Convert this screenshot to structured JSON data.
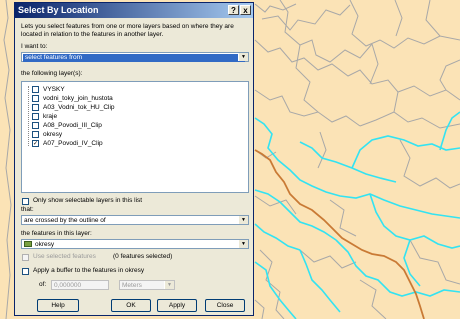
{
  "dialog": {
    "title": "Select By Location",
    "help_glyph": "?",
    "close_glyph": "x",
    "intro": "Lets you select features from one or more layers based on where they are located in relation to the features in another layer.",
    "i_want_to_label": "I want to:",
    "method": "select features from",
    "following_layers_label": "the following layer(s):",
    "layers": [
      {
        "name": "VYSKY",
        "checked": false
      },
      {
        "name": "vodni_toky_join_hustota",
        "checked": false
      },
      {
        "name": "A03_Vodni_tok_HU_Clip",
        "checked": false
      },
      {
        "name": "kraje",
        "checked": false
      },
      {
        "name": "A08_Povodi_III_Clip",
        "checked": false
      },
      {
        "name": "okresy",
        "checked": false
      },
      {
        "name": "A07_Povodi_IV_Clip",
        "checked": true
      }
    ],
    "only_show_selectable": "Only show selectable layers in this list",
    "that_label": "that:",
    "relation": "are crossed by the outline of",
    "features_in_layer_label": "the features in this layer:",
    "target_layer": "okresy",
    "use_selected": "Use selected features",
    "features_selected": "(0 features selected)",
    "apply_buffer": "Apply a buffer to the features in okresy",
    "of_label": "of:",
    "buffer_value": "0,000000",
    "buffer_unit": "Meters",
    "buttons": {
      "help": "Help",
      "ok": "OK",
      "apply": "Apply",
      "close": "Close"
    }
  },
  "colors": {
    "map_background": "#fbe3b6",
    "boundary_lines": "#a8a8a8",
    "river_cyan": "#33e3f2",
    "river_orange": "#c97a35"
  }
}
